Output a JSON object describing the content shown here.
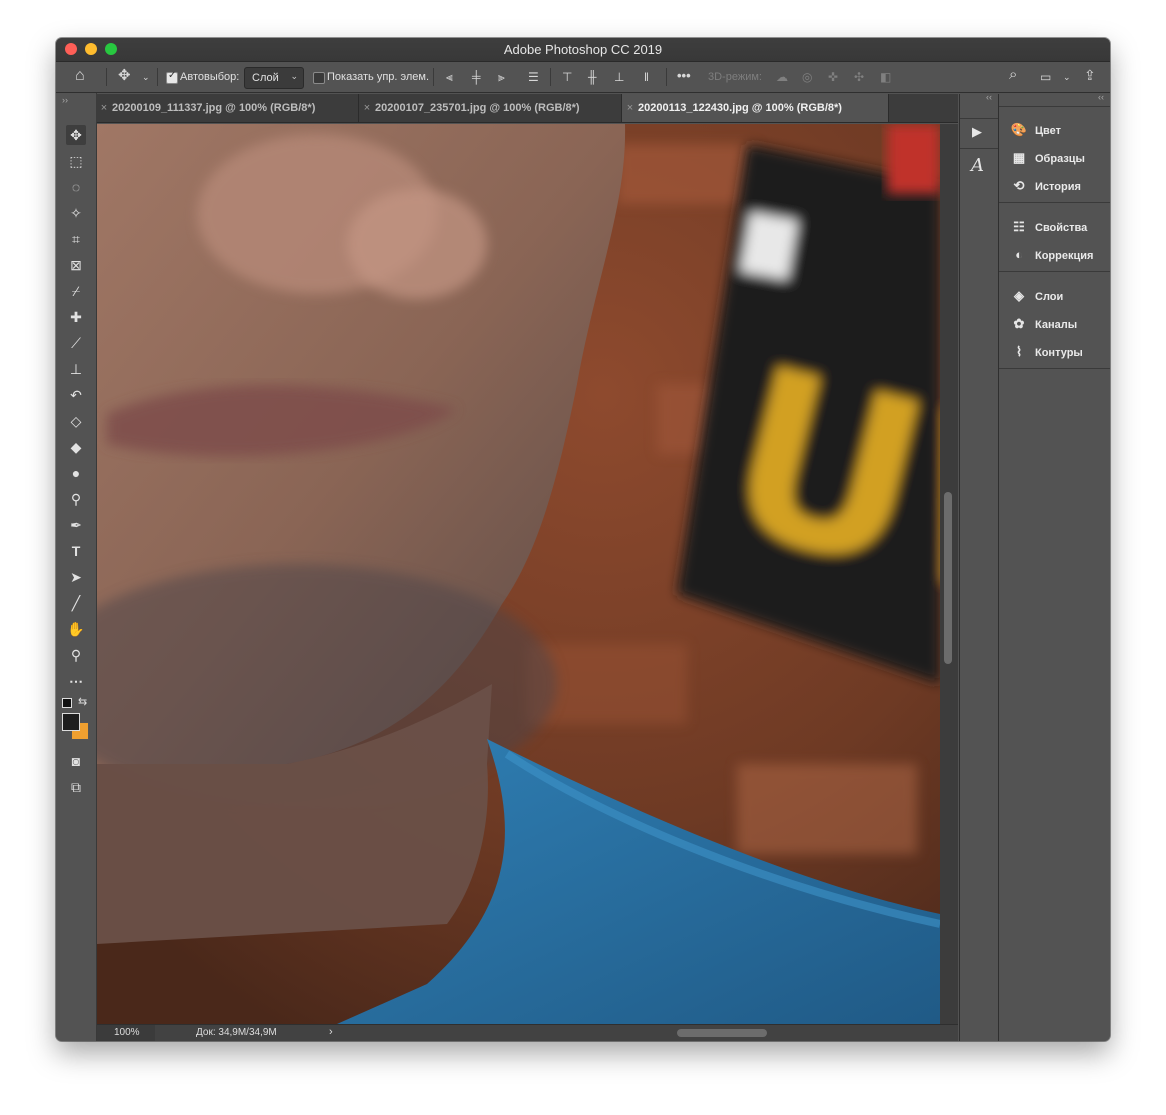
{
  "window": {
    "title": "Adobe Photoshop CC 2019"
  },
  "options_bar": {
    "auto_select_label": "Автовыбор:",
    "auto_select_value": "Слой",
    "show_transform_label": "Показать упр. элем.",
    "more_label": "•••",
    "mode_3d_label": "3D-режим:"
  },
  "tabs": [
    {
      "label": "20200109_111337.jpg @ 100% (RGB/8*)",
      "active": false
    },
    {
      "label": "20200107_235701.jpg @ 100% (RGB/8*)",
      "active": false
    },
    {
      "label": "20200113_122430.jpg @ 100% (RGB/8*)",
      "active": true
    }
  ],
  "status": {
    "zoom": "100%",
    "doc": "Док: 34,9M/34,9M",
    "arrow": "›"
  },
  "panels": {
    "group1": [
      {
        "label": "Цвет",
        "icon": "palette-icon",
        "glyph": "🎨"
      },
      {
        "label": "Образцы",
        "icon": "swatches-icon",
        "glyph": "▦"
      },
      {
        "label": "История",
        "icon": "history-icon",
        "glyph": "⟲"
      }
    ],
    "group2": [
      {
        "label": "Свойства",
        "icon": "properties-icon",
        "glyph": "☷"
      },
      {
        "label": "Коррекция",
        "icon": "adjustments-icon",
        "glyph": "◐"
      }
    ],
    "group3": [
      {
        "label": "Слои",
        "icon": "layers-icon",
        "glyph": "◈"
      },
      {
        "label": "Каналы",
        "icon": "channels-icon",
        "glyph": "✿"
      },
      {
        "label": "Контуры",
        "icon": "paths-icon",
        "glyph": "⌇"
      }
    ]
  },
  "colors": {
    "foreground": "#1e1e1e",
    "background": "#f0a030",
    "accent": "#2d8ff0"
  }
}
